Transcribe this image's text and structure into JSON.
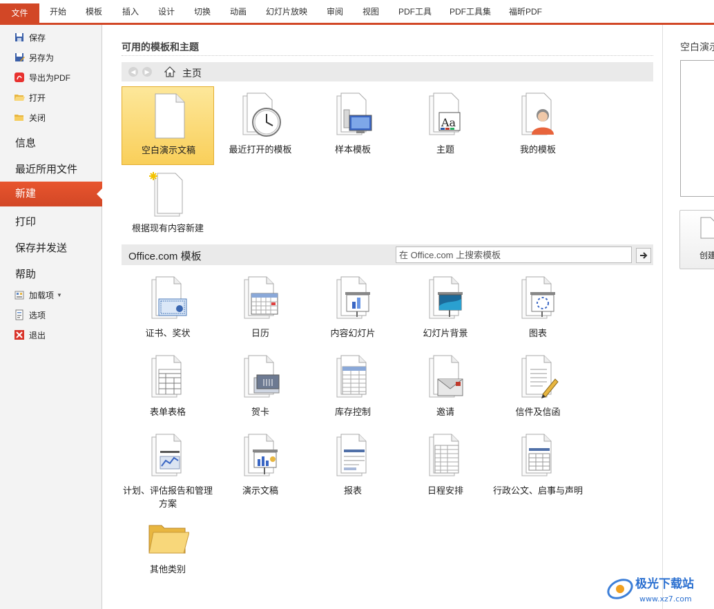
{
  "ribbon": {
    "file_tab": "文件",
    "tabs": [
      "开始",
      "模板",
      "插入",
      "设计",
      "切换",
      "动画",
      "幻灯片放映",
      "审阅",
      "视图",
      "PDF工具",
      "PDF工具集",
      "福昕PDF"
    ]
  },
  "leftnav": {
    "save": "保存",
    "save_as": "另存为",
    "export_pdf": "导出为PDF",
    "open": "打开",
    "close": "关闭",
    "info": "信息",
    "recent": "最近所用文件",
    "new": "新建",
    "print": "打印",
    "save_send": "保存并发送",
    "help": "帮助",
    "addins": "加载项",
    "options": "选项",
    "exit": "退出"
  },
  "main": {
    "available_title": "可用的模板和主题",
    "home_label": "主页",
    "tiles": [
      {
        "label": "空白演示文稿",
        "icon": "blank-document-icon"
      },
      {
        "label": "最近打开的模板",
        "icon": "recent-clock-icon"
      },
      {
        "label": "样本模板",
        "icon": "sample-template-icon"
      },
      {
        "label": "主题",
        "icon": "theme-aa-icon"
      },
      {
        "label": "我的模板",
        "icon": "person-template-icon"
      },
      {
        "label": "根据现有内容新建",
        "icon": "new-from-existing-icon"
      }
    ],
    "office_title": "Office.com 模板",
    "search_placeholder": "在 Office.com 上搜索模板",
    "office_tiles": [
      {
        "label": "证书、奖状",
        "icon": "certificate-icon"
      },
      {
        "label": "日历",
        "icon": "calendar-icon"
      },
      {
        "label": "内容幻灯片",
        "icon": "content-slide-icon"
      },
      {
        "label": "幻灯片背景",
        "icon": "slide-background-icon"
      },
      {
        "label": "图表",
        "icon": "diagram-icon"
      },
      {
        "label": "表单表格",
        "icon": "form-table-icon"
      },
      {
        "label": "贺卡",
        "icon": "greeting-card-icon"
      },
      {
        "label": "库存控制",
        "icon": "inventory-icon"
      },
      {
        "label": "邀请",
        "icon": "invitation-icon"
      },
      {
        "label": "信件及信函",
        "icon": "letter-icon"
      },
      {
        "label": "计划、评估报告和管理方案",
        "icon": "plan-report-icon"
      },
      {
        "label": "演示文稿",
        "icon": "presentation-icon"
      },
      {
        "label": "报表",
        "icon": "report-icon"
      },
      {
        "label": "日程安排",
        "icon": "schedule-icon"
      },
      {
        "label": "行政公文、启事与声明",
        "icon": "official-document-icon"
      },
      {
        "label": "其他类别",
        "icon": "folder-icon"
      }
    ]
  },
  "preview": {
    "title": "空白演示",
    "create_label": "创建"
  },
  "watermark": {
    "text": "极光下载站",
    "url": "www.xz7.com"
  }
}
